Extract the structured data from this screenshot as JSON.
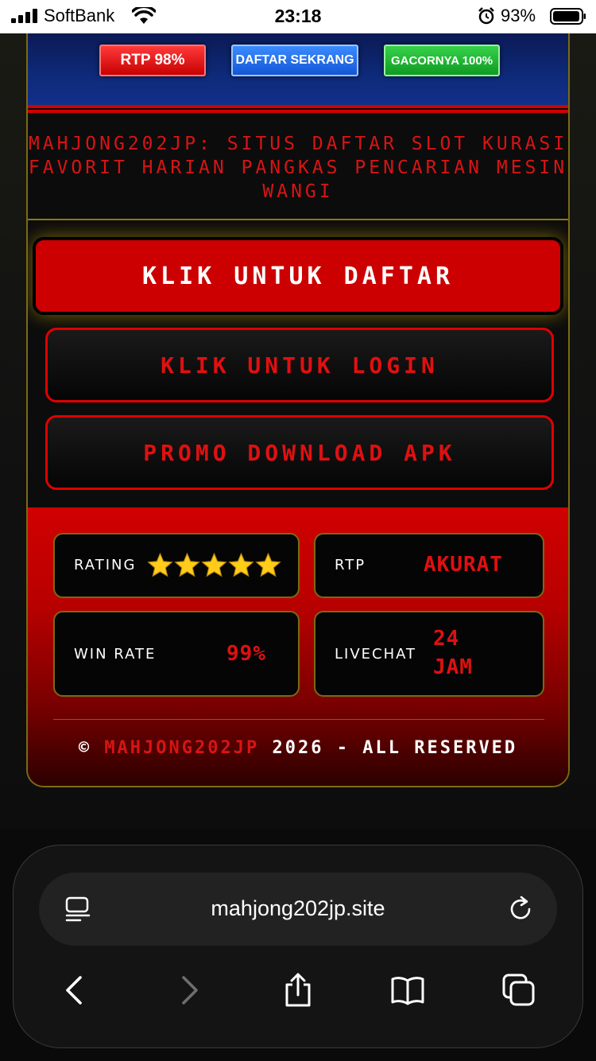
{
  "status_bar": {
    "carrier": "SoftBank",
    "time": "23:18",
    "battery_percent": "93%"
  },
  "banner": {
    "buttons": [
      {
        "label": "RTP 98%",
        "color": "#e00000"
      },
      {
        "label": "DAFTAR SEKRANG",
        "color": "#1f6ae8"
      },
      {
        "label": "GACORNYA 100%",
        "color": "#1db334"
      }
    ]
  },
  "headline": "MAHJONG202JP: SITUS DAFTAR SLOT KURASI FAVORIT HARIAN PANGKAS PENCARIAN MESIN WANGI",
  "actions": {
    "daftar": "KLIK UNTUK DAFTAR",
    "login": "KLIK UNTUK LOGIN",
    "apk": "PROMO DOWNLOAD APK"
  },
  "info": {
    "rating": {
      "label": "RATING",
      "stars": 5
    },
    "rtp": {
      "label": "RTP",
      "value": "AKURAT"
    },
    "win_rate": {
      "label": "WIN RATE",
      "value": "99%"
    },
    "livechat": {
      "label": "LIVECHAT",
      "value_line1": "24",
      "value_line2": "JAM"
    }
  },
  "footer": {
    "copyright_symbol": "©",
    "brand": "MAHJONG202JP",
    "suffix": "2026 - ALL RESERVED"
  },
  "browser": {
    "url": "mahjong202jp.site"
  },
  "colors": {
    "accent_red": "#d81414",
    "gold_border": "#7a6a12"
  }
}
